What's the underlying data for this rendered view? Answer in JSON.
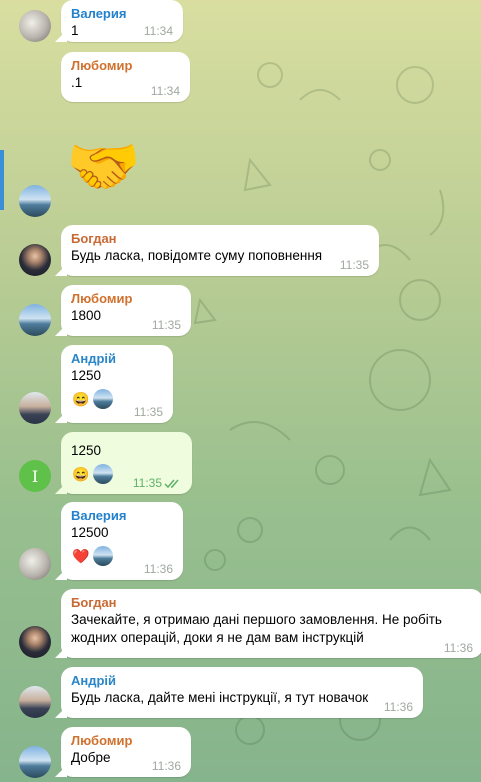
{
  "messages": [
    {
      "sender": "Валерия",
      "text": "1",
      "time": "11:34"
    },
    {
      "sender": "Любомир",
      "text": ".1",
      "time": "11:34"
    },
    {
      "sticker": "🤝"
    },
    {
      "sender": "Богдан",
      "text": "Будь ласка, повідомте суму поповнення",
      "time": "11:35"
    },
    {
      "sender": "Любомир",
      "text": "1800",
      "time": "11:35"
    },
    {
      "sender": "Андрій",
      "text": "1250",
      "time": "11:35",
      "reaction": "😄"
    },
    {
      "text": "1250",
      "time": "11:35",
      "reaction": "😄",
      "avatar_letter": "I"
    },
    {
      "sender": "Валерия",
      "text": "12500",
      "time": "11:36",
      "reaction": "❤️"
    },
    {
      "sender": "Богдан",
      "text_line1": "Зачекайте, я отримаю дані першого замовлення. Не робіть",
      "text_line2": "жодних операцій, доки я не дам вам інструкцій",
      "time": "11:36"
    },
    {
      "sender": "Андрій",
      "text": "Будь ласка, дайте мені інструкції, я тут новачок",
      "time": "11:36"
    },
    {
      "sender": "Любомир",
      "text": "Добре",
      "time": "11:36"
    }
  ],
  "colors": {
    "accent": "#3a8fd6",
    "own_bubble": "#effdde",
    "online_green": "#5fc149"
  }
}
